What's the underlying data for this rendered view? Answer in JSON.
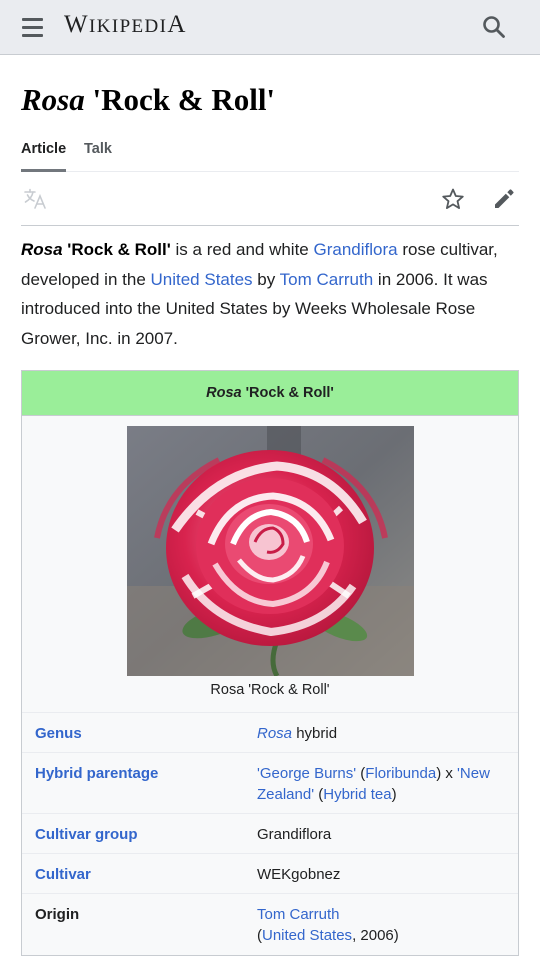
{
  "header": {
    "menu_icon": "hamburger-menu-icon",
    "logo": {
      "first": "W",
      "middle": "IKIPEDI",
      "last": "A"
    },
    "search_icon": "search-icon"
  },
  "page": {
    "title_italic": "Rosa",
    "title_rest": " 'Rock & Roll'"
  },
  "tabs": [
    {
      "label": "Article",
      "active": true
    },
    {
      "label": "Talk",
      "active": false
    }
  ],
  "actions": {
    "language_icon": "translate-icon",
    "watch_icon": "star-icon",
    "edit_icon": "pencil-icon"
  },
  "lead": {
    "name_italic": "Rosa",
    "name_rest": " 'Rock & Roll'",
    "t1": " is a red and white ",
    "link1": "Grandiflora",
    "t2": " rose cultivar, developed in the ",
    "link2": "United States",
    "t3": " by ",
    "link3": "Tom Carruth",
    "t4": " in 2006. It was introduced into the United States by Weeks Wholesale Rose Grower, Inc. in 2007."
  },
  "infobox": {
    "header_italic": "Rosa",
    "header_rest": " 'Rock & Roll'",
    "header_color": "#9aee99",
    "image_caption": "Rosa 'Rock & Roll'",
    "rows": {
      "genus": {
        "label": "Genus",
        "value_link": "Rosa",
        "value_rest": " hybrid"
      },
      "parentage": {
        "label": "Hybrid parentage",
        "l1": "'George Burns'",
        "t1": " (",
        "l2": "Floribunda",
        "t2": ") x ",
        "l3": "'New Zealand'",
        "t3": " (",
        "l4": "Hybrid tea",
        "t4": ")"
      },
      "group": {
        "label": "Cultivar group",
        "value_link": "Grandiflora"
      },
      "cultivar": {
        "label": "Cultivar",
        "value": "WEKgobnez"
      },
      "origin": {
        "label": "Origin",
        "l1": "Tom Carruth",
        "t1": "(",
        "l2": "United States",
        "t2": ", 2006)"
      }
    }
  }
}
